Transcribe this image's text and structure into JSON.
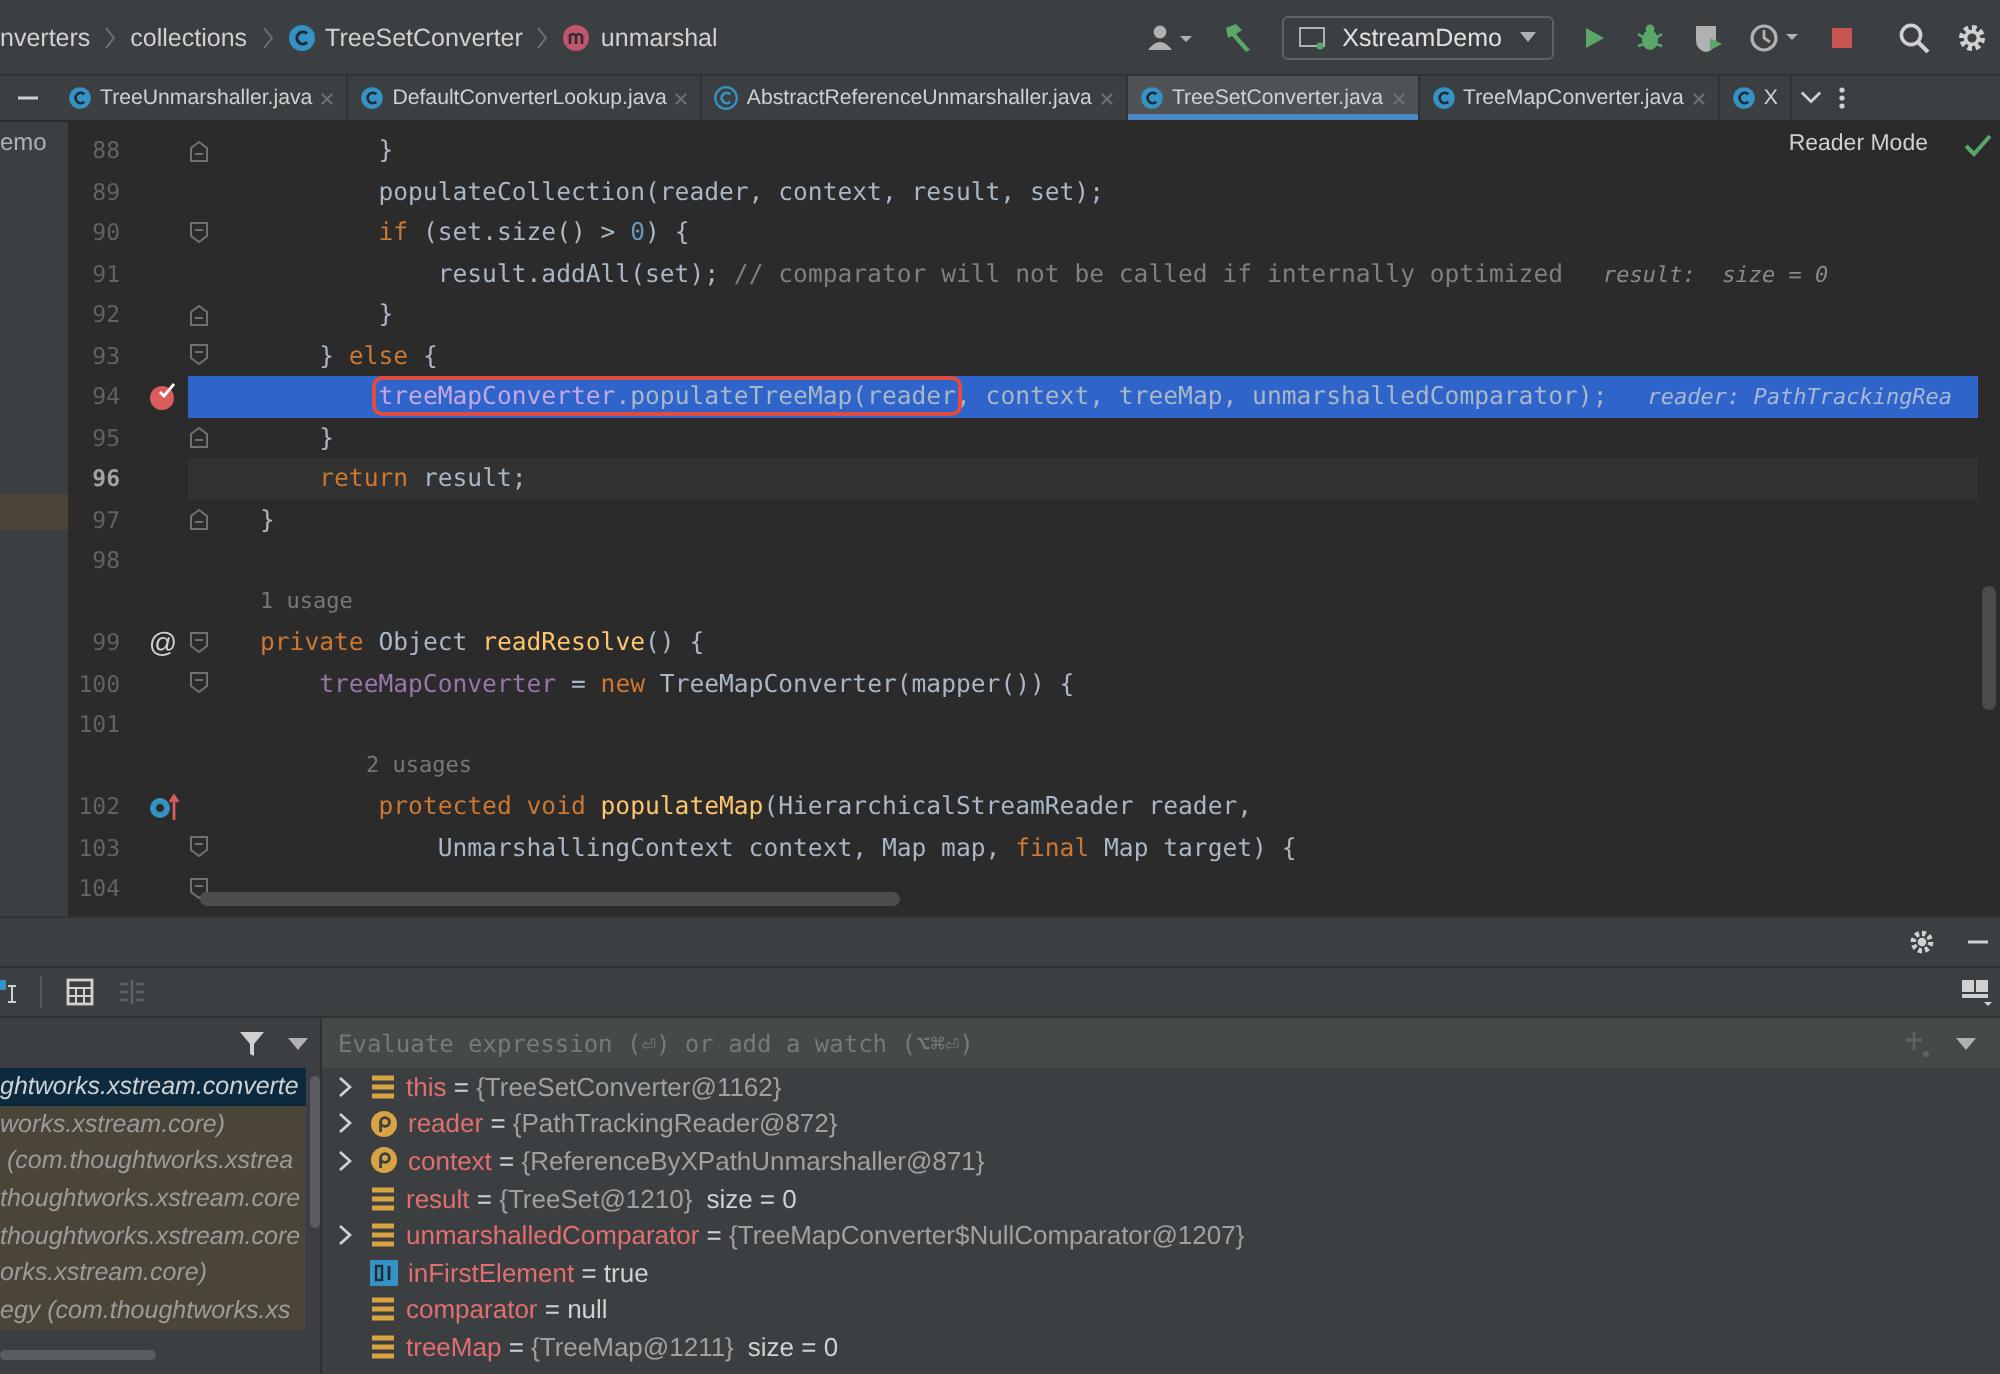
{
  "breadcrumbs": [
    {
      "label": "nverters",
      "kind": "folder"
    },
    {
      "label": "collections",
      "kind": "folder"
    },
    {
      "label": "TreeSetConverter",
      "kind": "class"
    },
    {
      "label": "unmarshal",
      "kind": "method"
    }
  ],
  "run_config": {
    "label": "XstreamDemo"
  },
  "tabs": [
    {
      "label": "TreeUnmarshaller.java",
      "kind": "class",
      "selected": false
    },
    {
      "label": "DefaultConverterLookup.java",
      "kind": "class",
      "selected": false
    },
    {
      "label": "AbstractReferenceUnmarshaller.java",
      "kind": "abstract",
      "selected": false
    },
    {
      "label": "TreeSetConverter.java",
      "kind": "class",
      "selected": true
    },
    {
      "label": "TreeMapConverter.java",
      "kind": "class",
      "selected": false
    },
    {
      "label": "X",
      "kind": "class",
      "selected": false
    }
  ],
  "project_panel": {
    "label": "emo"
  },
  "editor": {
    "reader_mode": "Reader Mode",
    "lines": [
      {
        "kind": "code",
        "number": "88",
        "fold_marker": {
          "kind": "end"
        },
        "tokens": [
          {
            "kind": "plain",
            "text": "        }"
          }
        ]
      },
      {
        "kind": "code",
        "number": "89",
        "tokens": [
          {
            "kind": "plain",
            "text": "        populateCollection(reader, context, result, set);"
          }
        ]
      },
      {
        "kind": "code",
        "number": "90",
        "fold_marker": {
          "kind": "start"
        },
        "tokens": [
          {
            "kind": "keyword",
            "text": "        if"
          },
          {
            "kind": "plain",
            "text": " (set.size() > "
          },
          {
            "kind": "number",
            "text": "0"
          },
          {
            "kind": "plain",
            "text": ") {"
          }
        ]
      },
      {
        "kind": "code",
        "number": "91",
        "tokens": [
          {
            "kind": "plain",
            "text": "            result.addAll(set); "
          },
          {
            "kind": "comment",
            "text": "// comparator will not be called if internally optimized"
          },
          {
            "kind": "hint",
            "text": "result:  size = 0"
          }
        ]
      },
      {
        "kind": "code",
        "number": "92",
        "fold_marker": {
          "kind": "end"
        },
        "tokens": [
          {
            "kind": "plain",
            "text": "        }"
          }
        ]
      },
      {
        "kind": "code",
        "number": "93",
        "fold_marker": {
          "kind": "start"
        },
        "tokens": [
          {
            "kind": "plain",
            "text": "    } "
          },
          {
            "kind": "keyword",
            "text": "else"
          },
          {
            "kind": "plain",
            "text": " {"
          }
        ]
      },
      {
        "kind": "code",
        "number": "94",
        "gutter": {
          "kind": "breakpoint"
        },
        "execution": true,
        "tokens": [
          {
            "kind": "box",
            "tokens": [
              {
                "kind": "field",
                "text": "        treeMapConverter"
              },
              {
                "kind": "plain",
                "text": ".populateTreeMap(reader"
              }
            ]
          },
          {
            "kind": "plain",
            "text": ", context, treeMap, unmarshalledComparator);"
          },
          {
            "kind": "hint",
            "text": "reader: PathTrackingRea"
          }
        ]
      },
      {
        "kind": "code",
        "number": "95",
        "fold_marker": {
          "kind": "end"
        },
        "tokens": [
          {
            "kind": "plain",
            "text": "    }"
          }
        ]
      },
      {
        "kind": "code",
        "number": "96",
        "current": true,
        "tokens": [
          {
            "kind": "keyword",
            "text": "    return"
          },
          {
            "kind": "plain",
            "text": " result;"
          }
        ]
      },
      {
        "kind": "code",
        "number": "97",
        "fold_marker": {
          "kind": "end"
        },
        "tokens": [
          {
            "kind": "plain",
            "text": "}"
          }
        ]
      },
      {
        "kind": "code",
        "number": "98"
      },
      {
        "kind": "usage",
        "text": "1 usage"
      },
      {
        "kind": "code",
        "number": "99",
        "fold_marker": {
          "kind": "start"
        },
        "gutter": {
          "kind": "text",
          "text": "@"
        },
        "tokens": [
          {
            "kind": "keyword",
            "text": "private"
          },
          {
            "kind": "plain",
            "text": " Object "
          },
          {
            "kind": "method",
            "text": "readResolve"
          },
          {
            "kind": "plain",
            "text": "() {"
          }
        ]
      },
      {
        "kind": "code",
        "number": "100",
        "fold_marker": {
          "kind": "start"
        },
        "tokens": [
          {
            "kind": "field",
            "text": "    treeMapConverter"
          },
          {
            "kind": "plain",
            "text": " = "
          },
          {
            "kind": "keyword",
            "text": "new"
          },
          {
            "kind": "plain",
            "text": " TreeMapConverter(mapper()) {"
          }
        ]
      },
      {
        "kind": "code",
        "number": "101"
      },
      {
        "kind": "usage",
        "text": "        2 usages"
      },
      {
        "kind": "code",
        "number": "102",
        "gutter": {
          "kind": "override"
        },
        "tokens": [
          {
            "kind": "keyword",
            "text": "        protected void"
          },
          {
            "kind": "method",
            "text": " populateMap"
          },
          {
            "kind": "plain",
            "text": "(HierarchicalStreamReader reader,"
          }
        ]
      },
      {
        "kind": "code",
        "number": "103",
        "fold_marker": {
          "kind": "start"
        },
        "tokens": [
          {
            "kind": "plain",
            "text": "            UnmarshallingContext context, Map map, "
          },
          {
            "kind": "keyword",
            "text": "final"
          },
          {
            "kind": "plain",
            "text": " Map target) {"
          }
        ]
      },
      {
        "kind": "code",
        "number": "104",
        "fold_marker": {
          "kind": "start"
        }
      }
    ]
  },
  "debugger": {
    "frames": [
      {
        "label": "ghtworks.xstream.converte",
        "selected": true
      },
      {
        "label": "works.xstream.core)",
        "selected": false
      },
      {
        "label": " (com.thoughtworks.xstrea",
        "selected": false
      },
      {
        "label": "thoughtworks.xstream.core",
        "selected": false
      },
      {
        "label": "thoughtworks.xstream.core",
        "selected": false
      },
      {
        "label": "orks.xstream.core)",
        "selected": false
      },
      {
        "label": "egy (com.thoughtworks.xs",
        "selected": false
      }
    ],
    "watch_field": {
      "placeholder": "Evaluate expression (⏎) or add a watch (⌥⌘⏎)"
    },
    "variables": [
      {
        "kind": "field",
        "expandable": true,
        "name": "this",
        "sign": "=",
        "value": "{TreeSetConverter@1162}",
        "literal": false
      },
      {
        "kind": "param",
        "expandable": true,
        "name": "reader",
        "sign": "=",
        "value": "{PathTrackingReader@872}",
        "literal": false
      },
      {
        "kind": "param",
        "expandable": true,
        "name": "context",
        "sign": "=",
        "value": "{ReferenceByXPathUnmarshaller@871}",
        "literal": false
      },
      {
        "kind": "field",
        "expandable": false,
        "name": "result",
        "sign": "=",
        "value": "{TreeSet@1210}",
        "detail": "size = 0",
        "literal": false
      },
      {
        "kind": "field",
        "expandable": true,
        "name": "unmarshalledComparator",
        "sign": "=",
        "value": "{TreeMapConverter$NullComparator@1207}",
        "literal": false
      },
      {
        "kind": "primitive",
        "expandable": false,
        "name": "inFirstElement",
        "sign": "=",
        "value": "true",
        "literal": true
      },
      {
        "kind": "field",
        "expandable": false,
        "name": "comparator",
        "sign": "=",
        "value": "null",
        "literal": true
      },
      {
        "kind": "field",
        "expandable": false,
        "name": "treeMap",
        "sign": "=",
        "value": "{TreeMap@1211}",
        "detail": "size = 0",
        "literal": false
      }
    ]
  }
}
